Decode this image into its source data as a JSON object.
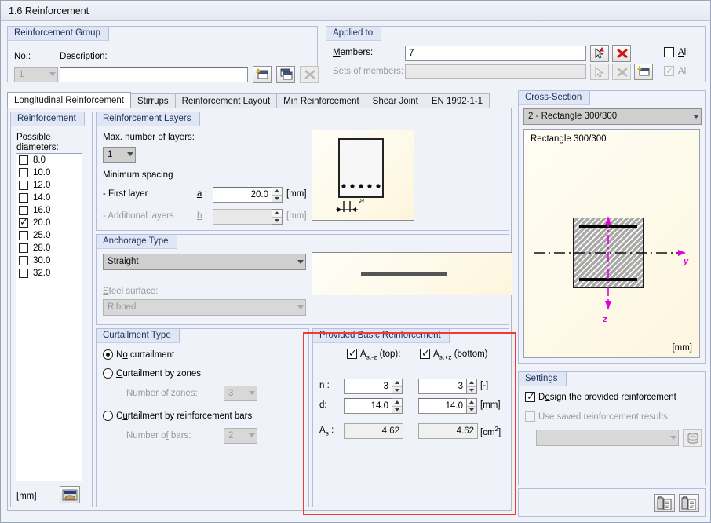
{
  "window": {
    "title": "1.6 Reinforcement"
  },
  "reinforcement_group": {
    "title": "Reinforcement Group",
    "no_label": "No.:",
    "no_value": "1",
    "description_label": "Description:",
    "description_value": "",
    "buttons": [
      {
        "name": "new-group-button",
        "icon": "new-window-icon"
      },
      {
        "name": "copy-group-button",
        "icon": "copy-window-icon"
      },
      {
        "name": "delete-group-button",
        "icon": "delete-x-icon"
      }
    ]
  },
  "applied_to": {
    "title": "Applied to",
    "members_label": "Members:",
    "members_value": "7",
    "sets_label": "Sets of members:",
    "sets_value": "",
    "all_label_1": "All",
    "all_label_2": "All",
    "all_checked_1": false,
    "all_checked_2": true
  },
  "tabs": [
    {
      "label": "Longitudinal Reinforcement",
      "selected": true
    },
    {
      "label": "Stirrups",
      "selected": false
    },
    {
      "label": "Reinforcement Layout",
      "selected": false
    },
    {
      "label": "Min Reinforcement",
      "selected": false
    },
    {
      "label": "Shear Joint",
      "selected": false
    },
    {
      "label": "EN 1992-1-1",
      "selected": false
    }
  ],
  "reinforcement_panel": {
    "title": "Reinforcement",
    "possible_diameters_label": "Possible\ndiameters:",
    "diameters": [
      {
        "value": "8.0",
        "checked": false
      },
      {
        "value": "10.0",
        "checked": false
      },
      {
        "value": "12.0",
        "checked": false
      },
      {
        "value": "14.0",
        "checked": false
      },
      {
        "value": "16.0",
        "checked": false
      },
      {
        "value": "20.0",
        "checked": true
      },
      {
        "value": "25.0",
        "checked": false
      },
      {
        "value": "28.0",
        "checked": false
      },
      {
        "value": "30.0",
        "checked": false
      },
      {
        "value": "32.0",
        "checked": false
      }
    ],
    "unit": "[mm]",
    "edit_button_icon": "library-edit-icon"
  },
  "reinforcement_layers": {
    "title": "Reinforcement Layers",
    "max_layers_label": "Max. number of layers:",
    "max_layers_value": "1",
    "min_spacing_label": "Minimum spacing",
    "first_layer_label": "- First layer",
    "first_layer_symbol": "a :",
    "first_layer_value": "20.0",
    "first_layer_unit": "[mm]",
    "additional_layers_label": "- Additional layers",
    "additional_layers_symbol": "b :",
    "additional_layers_value": "",
    "additional_layers_unit": "[mm]",
    "diagram_label": "a"
  },
  "anchorage_type": {
    "title": "Anchorage Type",
    "type_value": "Straight",
    "steel_surface_label": "Steel surface:",
    "steel_surface_value": "Ribbed"
  },
  "curtailment_type": {
    "title": "Curtailment Type",
    "options": [
      {
        "label": "No curtailment",
        "selected": true
      },
      {
        "label": "Curtailment by zones",
        "selected": false
      },
      {
        "label": "Curtailment by reinforcement bars",
        "selected": false
      }
    ],
    "zones_label": "Number of zones:",
    "zones_value": "3",
    "bars_label": "Number of bars:",
    "bars_value": "2"
  },
  "provided_basic_reinforcement": {
    "title": "Provided Basic Reinforcement",
    "highlight_color": "#ef3b36",
    "top_checkbox_label": "A",
    "top_checkbox_sub": "s,-z",
    "top_checkbox_tail": " (top):",
    "top_checked": true,
    "bottom_checkbox_label": "A",
    "bottom_checkbox_sub": "s,+z",
    "bottom_checkbox_tail": " (bottom)",
    "bottom_checked": true,
    "rows": [
      {
        "symbol": "n :",
        "top": "3",
        "bottom": "3",
        "unit": "[-]",
        "readonly": false
      },
      {
        "symbol": "d:",
        "top": "14.0",
        "bottom": "14.0",
        "unit": "[mm]",
        "readonly": false
      }
    ],
    "as_symbol": "A",
    "as_sub": "s",
    "as_tail": " :",
    "as_top": "4.62",
    "as_bottom": "4.62",
    "as_unit_pre": "[cm",
    "as_unit_sup": "2",
    "as_unit_post": "]"
  },
  "cross_section": {
    "title": "Cross-Section",
    "selected": "2 - Rectangle 300/300",
    "caption": "Rectangle 300/300",
    "unit": "[mm]",
    "axis_y": "y",
    "axis_z": "z"
  },
  "settings": {
    "title": "Settings",
    "design_provided_label": "Design the provided reinforcement",
    "design_provided_checked": true,
    "use_saved_label": "Use saved reinforcement results:",
    "use_saved_checked": false,
    "saved_results_value": "",
    "saved_results_button_icon": "database-icon"
  },
  "footer_buttons": [
    {
      "name": "copy-settings-button",
      "icon": "clipboard-copy-icon"
    },
    {
      "name": "paste-settings-button",
      "icon": "clipboard-paste-icon"
    }
  ]
}
